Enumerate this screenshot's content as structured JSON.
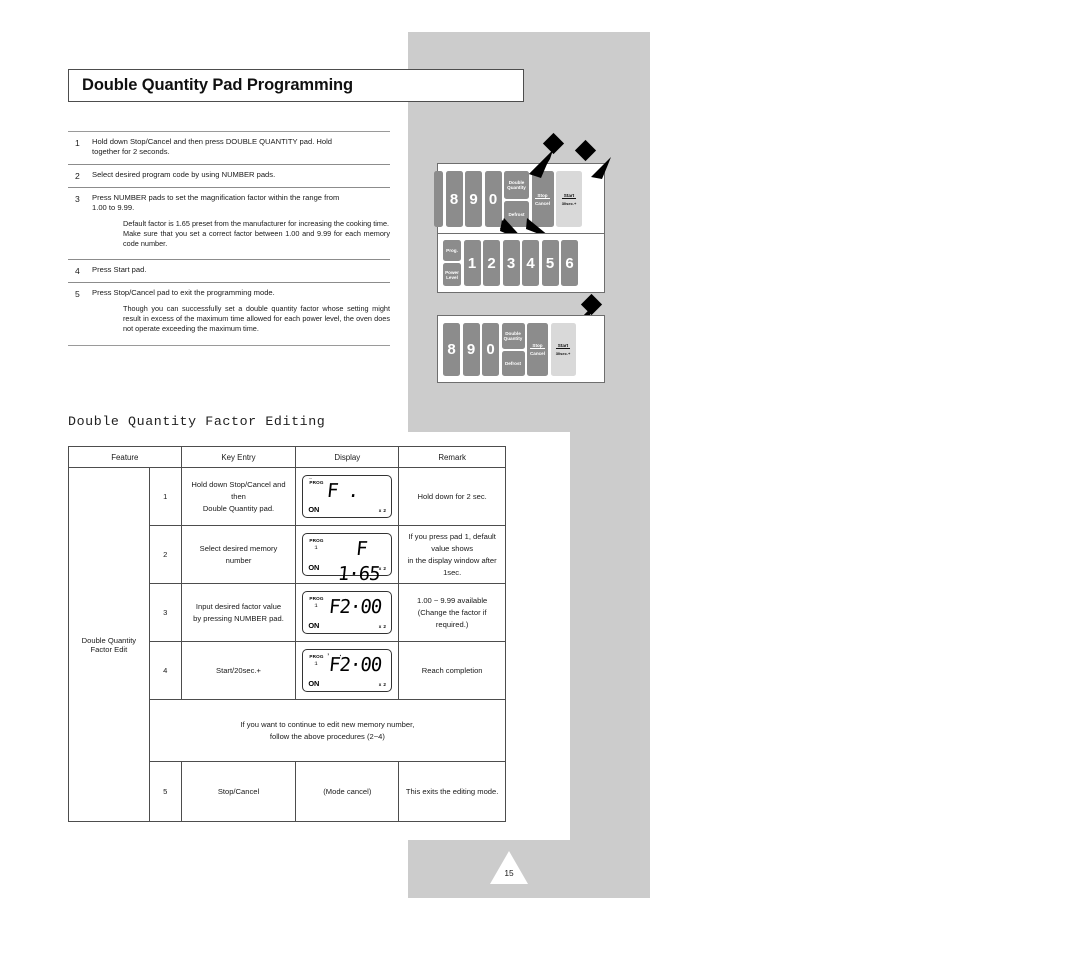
{
  "page": {
    "title": "Double Quantity Pad Programming",
    "page_number": "15",
    "section_title": "Double Quantity Factor Editing"
  },
  "steps": [
    {
      "num": "1",
      "lines": [
        "Hold down  Stop/Cancel and then press DOUBLE QUANTITY pad. Hold",
        "together for 2 seconds."
      ],
      "notes": []
    },
    {
      "num": "2",
      "lines": [
        "Select desired program code by using NUMBER pads."
      ],
      "notes": []
    },
    {
      "num": "3",
      "lines": [
        "Press NUMBER pads to set the magnification factor within the range from",
        "1.00 to 9.99."
      ],
      "notes": [
        "Default factor is 1.65 preset from the manufacturer for increasing the cooking time.",
        "Make sure that you set a correct factor between 1.00 and 9.99 for each memory code number."
      ]
    },
    {
      "num": "4",
      "lines": [
        "Press Start pad."
      ],
      "notes": []
    },
    {
      "num": "5",
      "lines": [
        "Press Stop/Cancel pad to exit the programming mode."
      ],
      "notes": [
        "Though you can successfully set a double quantity factor whose setting might result in excess of the maximum time allowed for each power level, the oven does not operate exceeding the maximum time."
      ]
    }
  ],
  "panels": [
    {
      "name": "panel-top",
      "numbers": [
        "8",
        "9",
        "0"
      ],
      "double_quantity": [
        "Double",
        "Quantity"
      ],
      "defrost": "Defrost",
      "stop": "Stop",
      "cancel": "Cancel",
      "start": "Start",
      "start_sub": "30sec.+"
    },
    {
      "name": "panel-middle",
      "prog": "Prog.",
      "power": "Power",
      "level": "Level",
      "numbers": [
        "1",
        "2",
        "3",
        "4",
        "5",
        "6"
      ]
    },
    {
      "name": "panel-bottom",
      "numbers": [
        "8",
        "9",
        "0"
      ],
      "double_quantity": [
        "Double",
        "Quantity"
      ],
      "defrost": "Defrost",
      "stop": "Stop",
      "cancel": "Cancel",
      "start": "Start",
      "start_sub": "30sec.+"
    }
  ],
  "table": {
    "headers": [
      "Feature",
      "Key Entry",
      "Display",
      "Remark"
    ],
    "feature_label": [
      "Double Quantity",
      "Factor Edit"
    ],
    "rows": [
      {
        "idx": "1",
        "key_entry": [
          "Hold down Stop/Cancel and then",
          "Double Quantity pad."
        ],
        "display": {
          "prog": "PROG",
          "mem": "",
          "digits": "F .",
          "on": "ON",
          "x2": "x 2",
          "flash": true
        },
        "remark": [
          "Hold down for 2 sec."
        ]
      },
      {
        "idx": "2",
        "key_entry": [
          "Select desired memory",
          "number"
        ],
        "display": {
          "prog": "PROG",
          "mem": "1",
          "digits": "F 1·65",
          "on": "ON",
          "x2": "x 2",
          "flash": false
        },
        "remark": [
          "If you press pad 1, default value shows",
          "in the display window after 1sec."
        ]
      },
      {
        "idx": "3",
        "key_entry": [
          "Input desired factor value",
          "by pressing NUMBER pad."
        ],
        "display": {
          "prog": "PROG",
          "mem": "1",
          "digits": "F2·00",
          "on": "ON",
          "x2": "x 2",
          "flash": false
        },
        "remark": [
          "1.00 ~ 9.99 available",
          "(Change the factor if required.)"
        ]
      },
      {
        "idx": "4",
        "key_entry": [
          "Start/20sec.+"
        ],
        "display": {
          "prog": "PROG",
          "mem": "1",
          "digits": "F2·00",
          "on": "ON",
          "x2": "x 2",
          "flash": true
        },
        "remark": [
          "Reach completion"
        ]
      }
    ],
    "note_row": [
      "If you want to continue to edit new memory number,",
      "follow the above procedures (2~4)"
    ],
    "last_row": {
      "idx": "5",
      "key_entry": [
        "Stop/Cancel"
      ],
      "display_text": "(Mode cancel)",
      "remark": [
        "This exits the editing mode."
      ]
    }
  },
  "colors": {
    "gray_panel": "#cccccc",
    "key_dark": "#8c8c8c",
    "key_light": "#d9d9d9",
    "text": "#1a1a1a"
  },
  "icons": {
    "arrow_marker": "arrow-marker-icon",
    "page_triangle": "page-triangle-icon"
  }
}
